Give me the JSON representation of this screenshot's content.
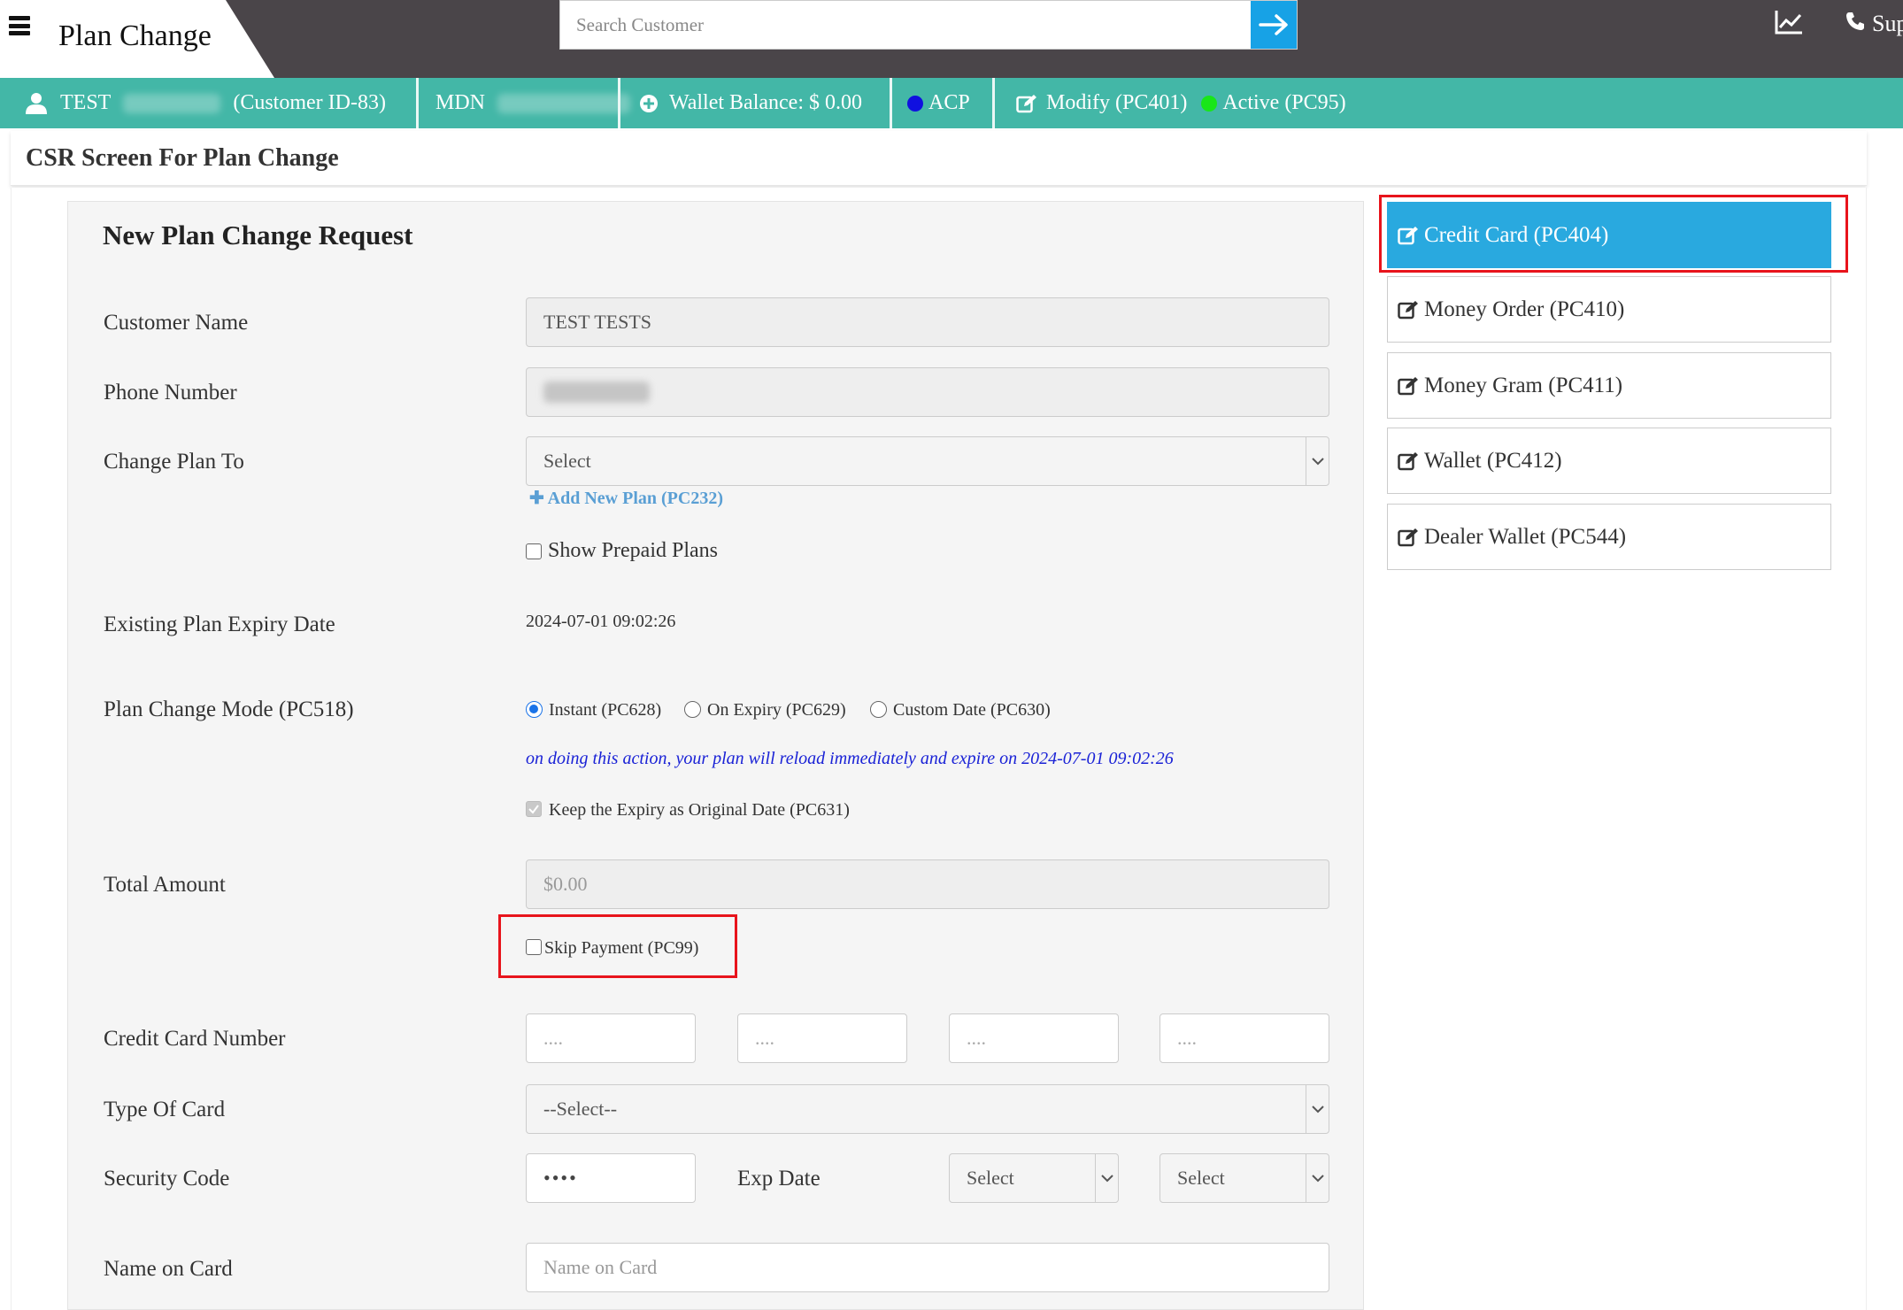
{
  "app": {
    "title": "Plan Change",
    "search_placeholder": "Search Customer",
    "support_label": "Sup"
  },
  "customer_bar": {
    "first_name": "TEST",
    "customer_id": "(Customer ID-83)",
    "mdn_label": "MDN",
    "wallet_balance": "Wallet Balance: $ 0.00",
    "acp_label": "ACP",
    "acp_color": "#1010e0",
    "modify_label": "Modify (PC401)",
    "status_label": "Active (PC95)",
    "status_color": "#19e619"
  },
  "section_title": "CSR Screen For Plan Change",
  "form": {
    "title": "New Plan Change Request",
    "customer_name_label": "Customer Name",
    "customer_name_value": "TEST  TESTS",
    "phone_label": "Phone Number",
    "change_plan_label": "Change Plan To",
    "change_plan_value": "Select",
    "add_new_plan": "Add New Plan (PC232)",
    "show_prepaid_label": "Show Prepaid Plans",
    "expiry_label": "Existing Plan Expiry Date",
    "expiry_value": "2024-07-01 09:02:26",
    "mode_label": "Plan Change Mode (PC518)",
    "mode_options": [
      "Instant (PC628)",
      "On Expiry (PC629)",
      "Custom Date (PC630)"
    ],
    "mode_selected": "Instant (PC628)",
    "mode_info": "on doing this action, your plan will reload immediately and expire on 2024-07-01 09:02:26",
    "keep_expiry_label": "Keep the Expiry as Original Date (PC631)",
    "total_label": "Total Amount",
    "total_value": "$0.00",
    "skip_payment_label": "Skip Payment (PC99)",
    "cc_number_label": "Credit Card Number",
    "cc_placeholder": "....",
    "card_type_label": "Type Of Card",
    "card_type_value": "--Select--",
    "security_label": "Security Code",
    "security_value": "••••",
    "exp_date_label": "Exp Date",
    "exp_month_value": "Select",
    "exp_year_value": "Select",
    "name_on_card_label": "Name on Card",
    "name_on_card_placeholder": "Name on Card"
  },
  "payment_methods": [
    {
      "label": "Credit Card (PC404)",
      "active": true
    },
    {
      "label": "Money Order (PC410)",
      "active": false
    },
    {
      "label": "Money Gram (PC411)",
      "active": false
    },
    {
      "label": "Wallet (PC412)",
      "active": false
    },
    {
      "label": "Dealer Wallet (PC544)",
      "active": false
    }
  ],
  "colors": {
    "topbar": "#4a4549",
    "customer_bar": "#43b7a7",
    "accent": "#29a9df",
    "highlight_box": "#e8141c"
  }
}
